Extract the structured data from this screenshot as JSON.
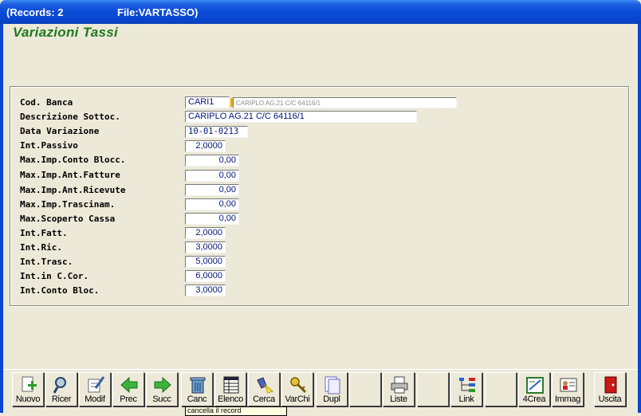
{
  "titlebar": {
    "records": "(Records: 2",
    "file": "File:VARTASSO)"
  },
  "form": {
    "title": "Variazioni Tassi"
  },
  "fields": {
    "cod_banca": {
      "label": "Cod. Banca",
      "value": "CARI1",
      "lookup": "CARIPLO AG.21 C/C 64116/1"
    },
    "descrizione": {
      "label": "Descrizione Sottoc.",
      "value": "CARIPLO AG.21 C/C 64116/1"
    },
    "data_variazione": {
      "label": "Data Variazione",
      "value": "10-01-0213"
    },
    "int_passivo": {
      "label": "Int.Passivo",
      "value": "2,0000"
    },
    "max_conto_blocc": {
      "label": "Max.Imp.Conto Blocc.",
      "value": "0,00"
    },
    "max_ant_fatture": {
      "label": "Max.Imp.Ant.Fatture",
      "value": "0,00"
    },
    "max_ant_ricevute": {
      "label": "Max.Imp.Ant.Ricevute",
      "value": "0,00"
    },
    "max_trascinam": {
      "label": "Max.Imp.Trascinam.",
      "value": "0,00"
    },
    "max_scoperto": {
      "label": "Max.Scoperto Cassa",
      "value": "0,00"
    },
    "int_fatt": {
      "label": "Int.Fatt.",
      "value": "2,0000"
    },
    "int_ric": {
      "label": "Int.Ric.",
      "value": "3,0000"
    },
    "int_trasc": {
      "label": "Int.Trasc.",
      "value": "5,0000"
    },
    "int_ccor": {
      "label": "Int.in C.Cor.",
      "value": "6,0000"
    },
    "int_conto_bloc": {
      "label": "Int.Conto Bloc.",
      "value": "3,0000"
    }
  },
  "toolbar": {
    "nuovo": "Nuovo",
    "ricer": "Ricer",
    "modif": "Modif",
    "prec": "Prec",
    "succ": "Succ",
    "canc": "Canc",
    "elenco": "Elenco",
    "cerca": "Cerca",
    "varchi": "VarChi",
    "dupl": "Dupl",
    "liste": "Liste",
    "link": "Link",
    "crea": "4Crea",
    "immag": "Immag",
    "uscita": "Uscita"
  },
  "tooltip": {
    "text": "cancella il record"
  },
  "colors": {
    "title_green": "#1e7a1e",
    "value_blue": "#00157a",
    "titlebar_blue": "#0a4bd6"
  }
}
